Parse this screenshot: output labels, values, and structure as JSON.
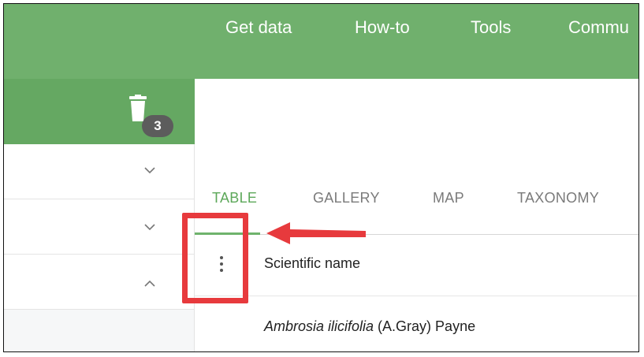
{
  "nav": {
    "items": [
      "Get data",
      "How-to",
      "Tools",
      "Commu"
    ]
  },
  "sidebar": {
    "badge_count": "3",
    "filters": [
      {
        "state": "collapsed"
      },
      {
        "state": "collapsed"
      },
      {
        "state": "expanded"
      }
    ]
  },
  "tabs": [
    {
      "label": "TABLE",
      "active": true
    },
    {
      "label": "GALLERY",
      "active": false
    },
    {
      "label": "MAP",
      "active": false
    },
    {
      "label": "TAXONOMY",
      "active": false
    }
  ],
  "table": {
    "column_header": "Scientific name",
    "rows": [
      {
        "species": "Ambrosia ilicifolia",
        "author": " (A.Gray) Payne"
      }
    ]
  },
  "annotation": {
    "color": "#e73a3d"
  },
  "colors": {
    "header_green": "#70b06d",
    "sidebar_green": "#65a862",
    "tab_active": "#5da85a"
  }
}
